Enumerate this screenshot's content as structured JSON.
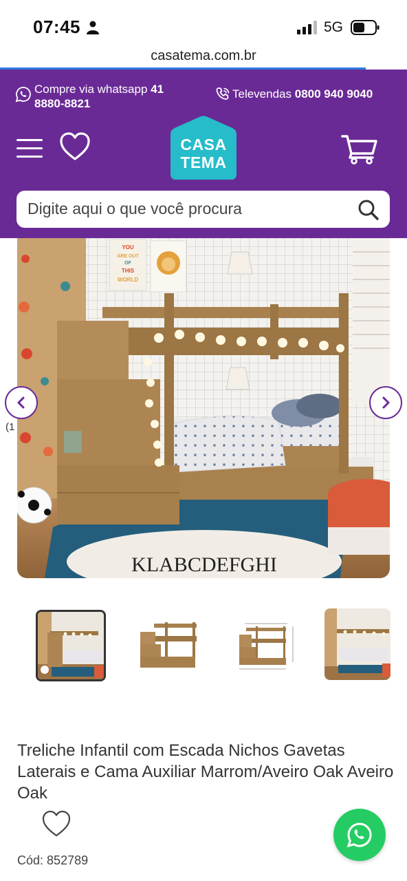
{
  "status_bar": {
    "time": "07:45",
    "network": "5G",
    "person_icon": "person-icon",
    "signal_icon": "signal-icon",
    "battery_icon": "battery-icon"
  },
  "browser": {
    "url": "casatema.com.br"
  },
  "header": {
    "bg_color": "#6a2a96",
    "whatsapp": {
      "label": "Compre via whatsapp",
      "number_part1": "41",
      "number_part2": "8880-8821",
      "icon": "whatsapp-icon"
    },
    "televendas": {
      "label": "Televendas",
      "number": "0800 940 9040",
      "icon": "phone-icon"
    },
    "logo": {
      "line1": "CASA",
      "line2": "TEMA",
      "color": "#26bcc9"
    },
    "menu_icon": "menu-icon",
    "favorites_icon": "heart-icon",
    "cart_icon": "cart-icon"
  },
  "search": {
    "placeholder": "Digite aqui o que você procura",
    "icon": "search-icon"
  },
  "gallery": {
    "hero_alt_artwork": [
      "YOU",
      "ARE OUT",
      "OF",
      "THIS",
      "WORLD"
    ],
    "rug_letters": "KLABCDEFGHI",
    "edge_fragment": "(1",
    "prev_icon": "chevron-left-icon",
    "next_icon": "chevron-right-icon",
    "thumbnails": [
      {
        "name": "room-photo",
        "active": true
      },
      {
        "name": "product-photo",
        "active": false
      },
      {
        "name": "dimensions-drawing",
        "active": false
      },
      {
        "name": "room-photo-2",
        "active": false
      }
    ]
  },
  "product": {
    "title": "Treliche Infantil com Escada Nichos Gavetas Laterais e Cama Auxiliar Marrom/Aveiro Oak Aveiro Oak",
    "code_label": "Cód:",
    "code": "852789",
    "favorite_icon": "heart-icon"
  },
  "floating": {
    "whatsapp_icon": "whatsapp-icon",
    "color": "#25cc63"
  }
}
